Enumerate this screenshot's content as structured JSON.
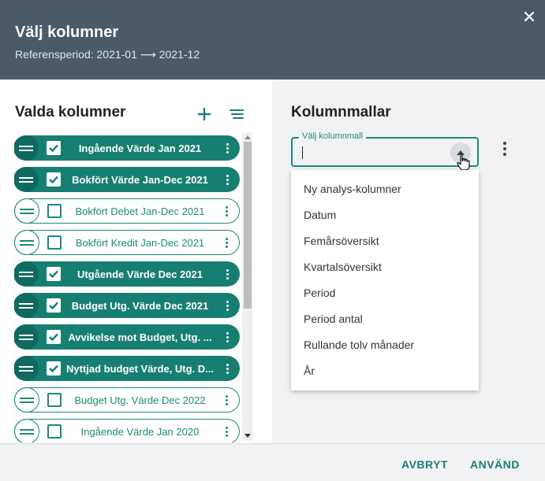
{
  "dialog": {
    "title": "Välj kolumner",
    "subtitle": "Referensperiod: 2021-01 ⟶ 2021-12",
    "close_icon": "close-icon"
  },
  "left_panel": {
    "title": "Valda kolumner",
    "add_icon": "plus-icon",
    "sort_icon": "sort-lines-icon",
    "rows": [
      {
        "label": "Ingående Värde Jan 2021",
        "checked": true
      },
      {
        "label": "Bokfört Värde Jan-Dec 2021",
        "checked": true
      },
      {
        "label": "Bokfört Debet Jan-Dec 2021",
        "checked": false
      },
      {
        "label": "Bokfört Kredit Jan-Dec 2021",
        "checked": false
      },
      {
        "label": "Utgående Värde Dec 2021",
        "checked": true
      },
      {
        "label": "Budget Utg. Värde Dec 2021",
        "checked": true
      },
      {
        "label": "Avvikelse mot Budget, Utg. ...",
        "checked": true
      },
      {
        "label": "Nyttjad budget Värde, Utg. D...",
        "checked": true
      },
      {
        "label": "Budget Utg. Värde Dec 2022",
        "checked": false
      },
      {
        "label": "Ingående Värde Jan 2020",
        "checked": false
      }
    ]
  },
  "right_panel": {
    "title": "Kolumnmallar",
    "select_label": "Välj kolumnmall",
    "select_value": "",
    "options": [
      "Ny analys-kolumner",
      "Datum",
      "Femårsöversikt",
      "Kvartalsöversikt",
      "Period",
      "Period antal",
      "Rullande tolv månader",
      "År"
    ]
  },
  "footer": {
    "cancel_label": "AVBRYT",
    "apply_label": "ANVÄND"
  },
  "colors": {
    "header": "#4a5a67",
    "accent": "#177f72",
    "panel": "#f1f2f3"
  }
}
